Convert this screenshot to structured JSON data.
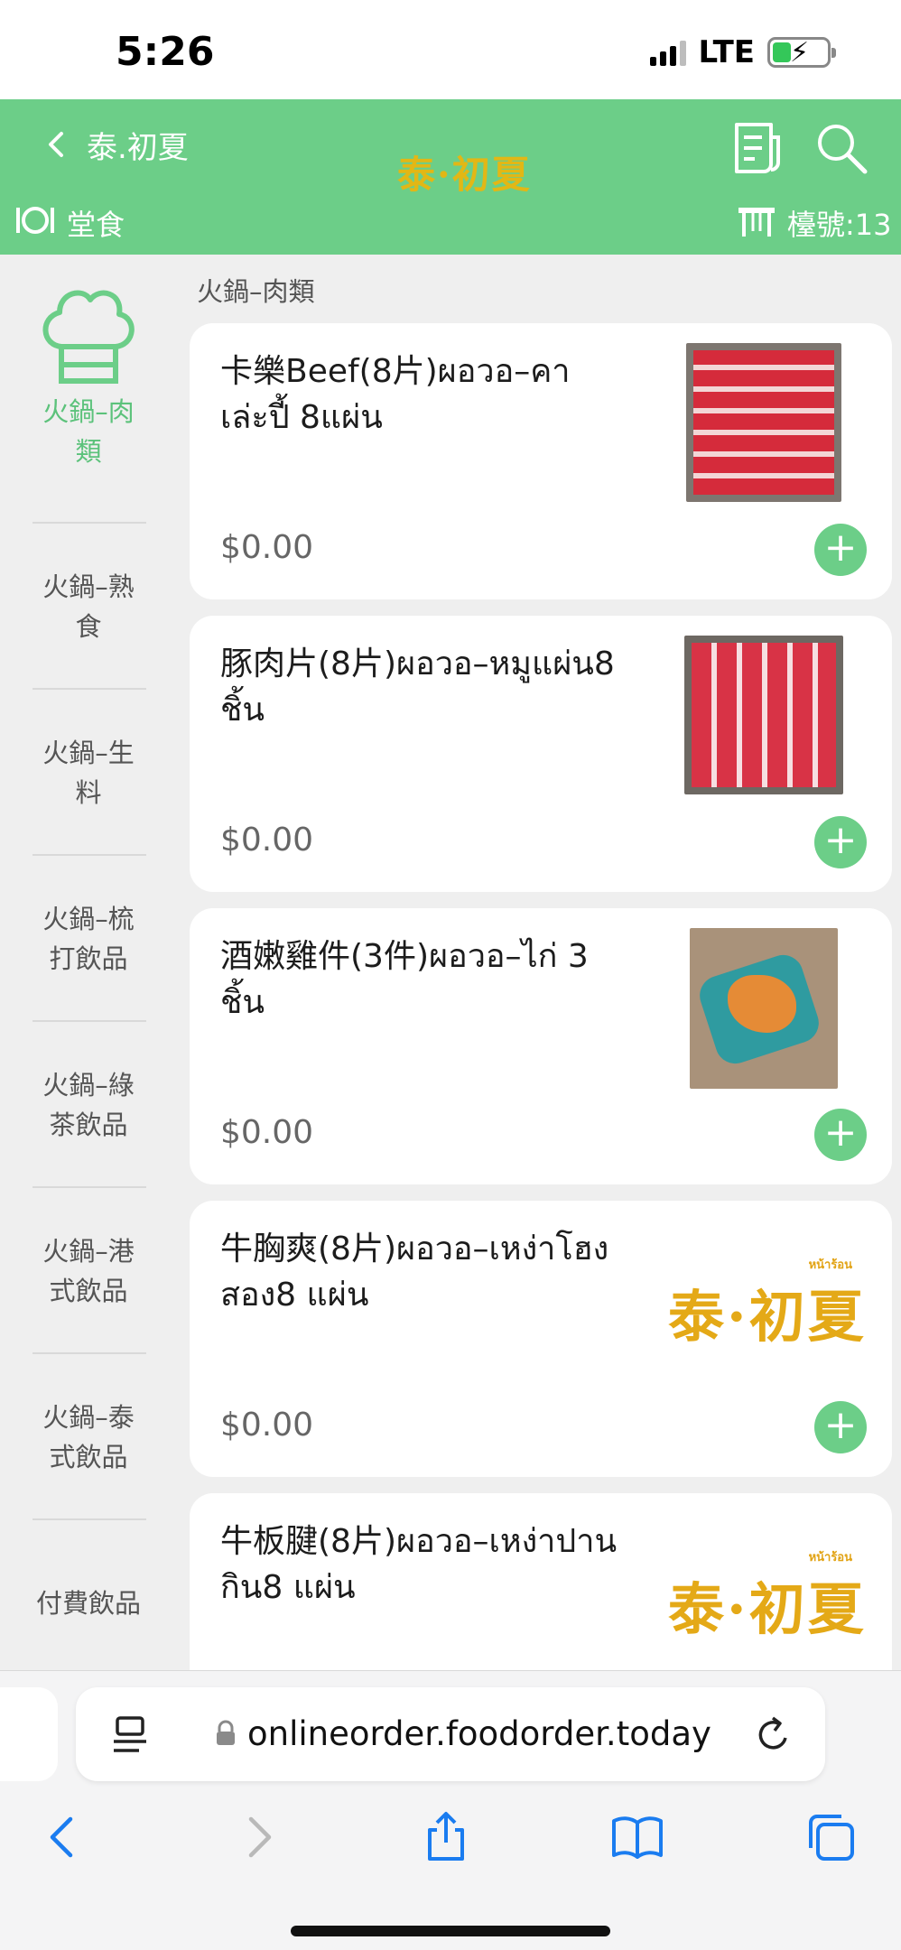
{
  "status_bar": {
    "time": "5:26",
    "network": "LTE"
  },
  "header": {
    "store_name": "泰.初夏",
    "logo_text": "泰·初夏",
    "mode_label": "堂食",
    "table_label": "檯號:13",
    "accent_color": "#6cce88"
  },
  "sidebar": {
    "active_label": "火鍋–肉類",
    "items": [
      {
        "label": "火鍋–熟食"
      },
      {
        "label": "火鍋–生料"
      },
      {
        "label": "火鍋–梳打飲品"
      },
      {
        "label": "火鍋–綠茶飲品"
      },
      {
        "label": "火鍋–港式飲品"
      },
      {
        "label": "火鍋–泰式飲品"
      },
      {
        "label": "付費飲品"
      }
    ]
  },
  "menu": {
    "section_title": "火鍋–肉類",
    "items": [
      {
        "name": "卡樂Beef(8片)ผอวอ–คาเล่ะปี้ 8แผ่น",
        "price": "$0.00",
        "image": "beef-slices-photo"
      },
      {
        "name": "豚肉片(8片)ผอวอ–หมูแผ่น8 ชิ้น",
        "price": "$0.00",
        "image": "pork-slices-photo"
      },
      {
        "name": "酒嫩雞件(3件)ผอวอ–ไก่ 3 ชิ้น",
        "price": "$0.00",
        "image": "chicken-photo"
      },
      {
        "name": "牛胸爽(8片)ผอวอ–เหง่าโฮงสอง8 แผ่น",
        "price": "$0.00",
        "image": "brand-logo"
      },
      {
        "name": "牛板腱(8片)ผอวอ–เหง่าปานกิน8 แผ่น",
        "price": "",
        "image": "brand-logo"
      }
    ],
    "placeholder_logo_main": "泰·初夏",
    "placeholder_logo_small": "หน้าร้อน"
  },
  "browser": {
    "url": "onlineorder.foodorder.today"
  }
}
